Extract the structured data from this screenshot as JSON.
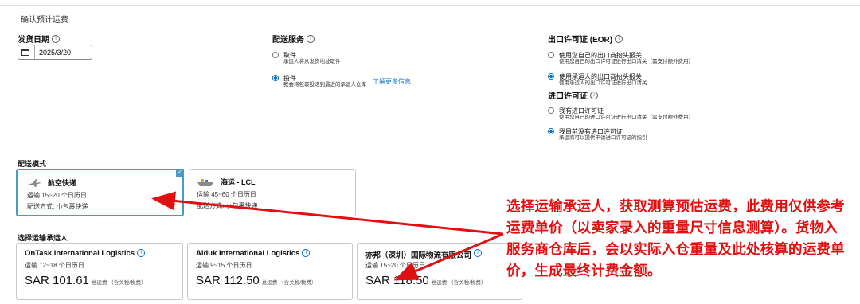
{
  "page": {
    "title": "确认预计运费"
  },
  "ship_date": {
    "label": "发货日期",
    "value": "2025/3/20"
  },
  "delivery_service": {
    "label": "配送服务",
    "options": [
      {
        "title": "取件",
        "desc": "承运人将从发货地址取件",
        "selected": false
      },
      {
        "title": "投件",
        "desc": "我会将包裹投递到最近的承运人仓库",
        "selected": true
      }
    ],
    "more_link": "了解更多信息"
  },
  "export_license": {
    "label": "出口许可证 (EOR)",
    "options": [
      {
        "title": "使用您自己的出口商抬头报关",
        "desc": "使用您自己的出口许可证进行出口清关（需支付额外费用）",
        "selected": false
      },
      {
        "title": "使用承运人的出口商抬头报关",
        "desc": "使用承运人的出口许可证进行出口清关",
        "selected": true
      }
    ]
  },
  "import_license": {
    "label": "进口许可证",
    "options": [
      {
        "title": "我有进口许可证",
        "desc": "使用您自己的进口许可证进行出口清关（需支付额外费用）",
        "selected": false
      },
      {
        "title": "我目前没有进口许可证",
        "desc": "承运商可以提供申请进口许可证的指引",
        "selected": true
      }
    ]
  },
  "shipping_mode": {
    "label": "配送模式",
    "modes": [
      {
        "name": "航空快递",
        "transit": "运输 15~20 个日历日",
        "method": "配送方式: 小包裹快递",
        "selected": true,
        "icon": "airplane-icon"
      },
      {
        "name": "海运 - LCL",
        "transit": "运输 45~60 个日历日",
        "method": "配送方式: 小包裹快递",
        "selected": false,
        "icon": "ship-icon"
      }
    ]
  },
  "carriers": {
    "label": "选择运输承运人",
    "items": [
      {
        "name": "OnTask International Logistics",
        "transit": "运输 12~18 个日历日",
        "price": "SAR 101.61",
        "note": "总运费 （含关税/税费）"
      },
      {
        "name": "Aiduk International Logistics",
        "transit": "运输 9~15 个日历日",
        "price": "SAR 112.50",
        "note": "总运费 （含关税/税费）"
      },
      {
        "name": "亦邦（深圳）国际物流有限公司",
        "transit": "运输 15~20 个日历日",
        "price": "SAR 118.50",
        "note": "总运费 （含关税/税费）"
      }
    ]
  },
  "annotation": {
    "text": "选择运输承运人，获取测算预估运费，此费用仅供参考运费单价（以卖家录入的重量尺寸信息测算）。货物入服务商仓库后，会以实际入仓重量及此处核算的运费单价，生成最终计费金额。",
    "color": "#e01010"
  }
}
